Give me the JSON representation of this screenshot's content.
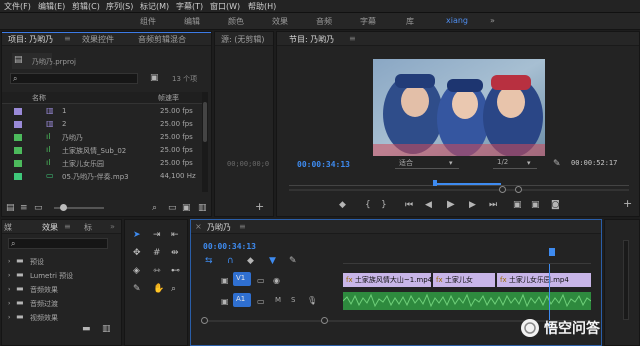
{
  "menu": [
    "文件(F)",
    "编辑(E)",
    "剪辑(C)",
    "序列(S)",
    "标记(M)",
    "字幕(T)",
    "窗口(W)",
    "帮助(H)"
  ],
  "workspace": {
    "tabs": [
      "组件",
      "编辑",
      "颜色",
      "效果",
      "音频",
      "字幕",
      "库"
    ],
    "active": "xiang",
    "more": "»"
  },
  "project": {
    "tab": "项目: 乃哟乃",
    "tab2": "效果控件",
    "tab3": "音频剪辑混合",
    "file": "乃哟乃.prproj",
    "count": "13 个项",
    "col_name": "名称",
    "col_rate": "帧速率",
    "items": [
      {
        "name": "1",
        "rate": "25.00 fps",
        "color": "#9a8ad8"
      },
      {
        "name": "2",
        "rate": "25.00 fps",
        "color": "#9a8ad8"
      },
      {
        "name": "乃哟乃",
        "rate": "25.00 fps",
        "color": "#4cba5c"
      },
      {
        "name": "土家族风情_Sub_02",
        "rate": "25.00 fps",
        "color": "#4cba5c"
      },
      {
        "name": "土家儿女乐园",
        "rate": "25.00 fps",
        "color": "#4cba5c"
      },
      {
        "name": "05.乃哟乃-伴奏.mp3",
        "rate": "44,100 Hz",
        "color": "#3fc87a"
      }
    ]
  },
  "source": {
    "title": "源: (无剪辑)",
    "timecode": "00;00;00;0"
  },
  "program": {
    "title": "节目: 乃哟乃",
    "current": "00:00:34:13",
    "fit": "适合",
    "quality": "1/2",
    "duration": "00:00:52:17"
  },
  "effects": {
    "tab_left": "媒",
    "tab": "效果",
    "tab3": "标",
    "items": [
      "预设",
      "Lumetri 预设",
      "音频效果",
      "音频过渡",
      "视频效果"
    ]
  },
  "timeline": {
    "title": "乃哟乃",
    "timecode": "00:00:34:13",
    "tracks": {
      "v1": "V1",
      "a1": "A1"
    },
    "m": "M",
    "s": "S",
    "clips": [
      {
        "label": "土家族风情大山~1.mp4",
        "color": "#c8b5e8"
      },
      {
        "label": "土家儿女",
        "color": "#c8b5e8"
      },
      {
        "label": "土家儿女乐园.mp4",
        "color": "#c8b5e8"
      }
    ]
  },
  "watermark": "悟空问答",
  "colors": {
    "accent": "#3e8bf0",
    "video_clip": "#c8b5e8",
    "audio_clip": "#2e8a3e"
  }
}
